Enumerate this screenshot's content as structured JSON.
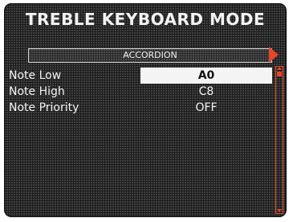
{
  "screen": {
    "title": "TREBLE KEYBOARD MODE"
  },
  "selector": {
    "label": "ACCORDION",
    "arrow_icon": "triangle-right-icon"
  },
  "settings": [
    {
      "label": "Note Low",
      "value": "A0",
      "selected": true
    },
    {
      "label": "Note High",
      "value": "C8",
      "selected": false
    },
    {
      "label": "Note Priority",
      "value": "OFF",
      "selected": false
    }
  ],
  "colors": {
    "accent": "#e8452a",
    "background": "#1c1c1c",
    "text": "#f2f2f2",
    "highlight": "#f4f4f4"
  }
}
